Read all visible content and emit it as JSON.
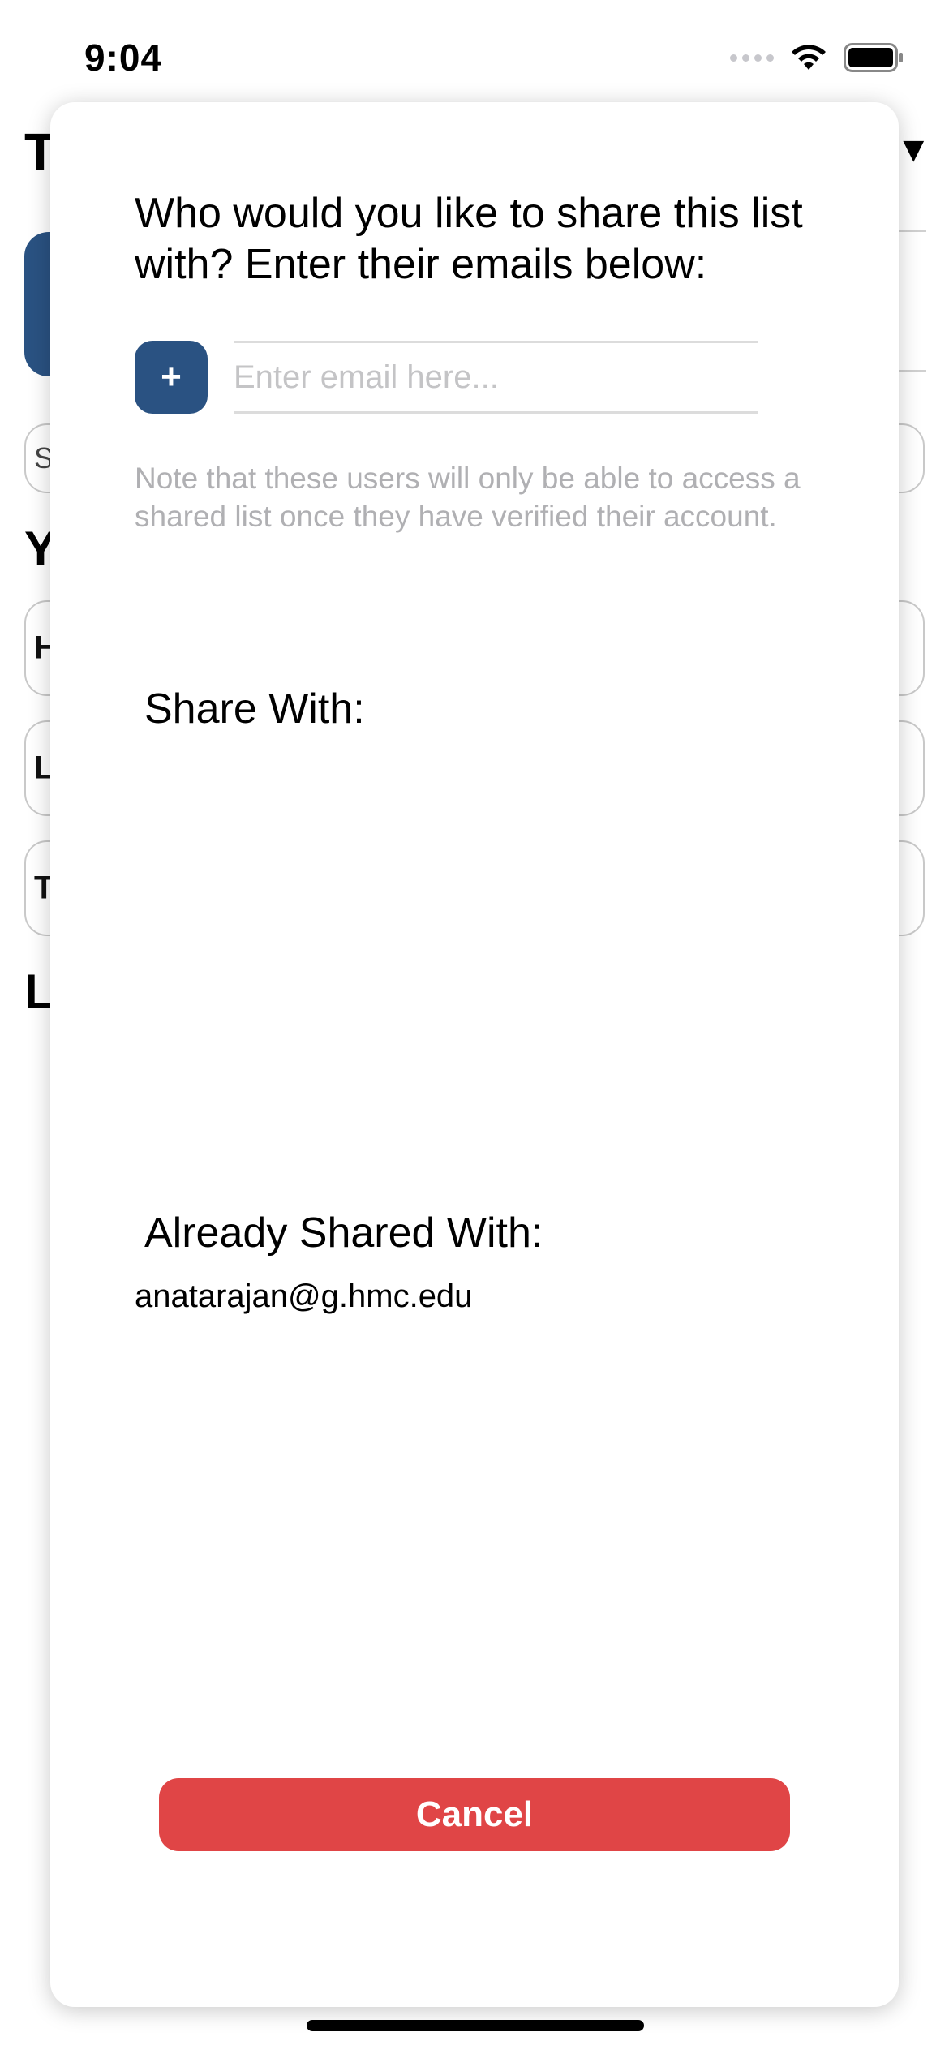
{
  "status_bar": {
    "time": "9:04",
    "icons": [
      "signal-icon",
      "wifi-icon",
      "battery-icon"
    ]
  },
  "background": {
    "title_letter": "T",
    "search_letter": "S",
    "section1_letter": "Y",
    "rows": [
      "H",
      "L",
      "To"
    ],
    "section2_letter": "L"
  },
  "modal": {
    "prompt": "Who would you like to share this list with? Enter their emails below:",
    "add_button_label": "+",
    "email_placeholder": "Enter email here...",
    "email_value": "",
    "note": "Note that these users will only be able to access a shared list once they have verified their account.",
    "share_with_title": "Share With:",
    "share_with_list": [],
    "already_shared_title": "Already Shared With:",
    "already_shared_list": [
      "anatarajan@g.hmc.edu"
    ],
    "cancel_label": "Cancel"
  },
  "colors": {
    "accent": "#2a5282",
    "cancel": "#e04546",
    "note_text": "#b0b0b3"
  }
}
